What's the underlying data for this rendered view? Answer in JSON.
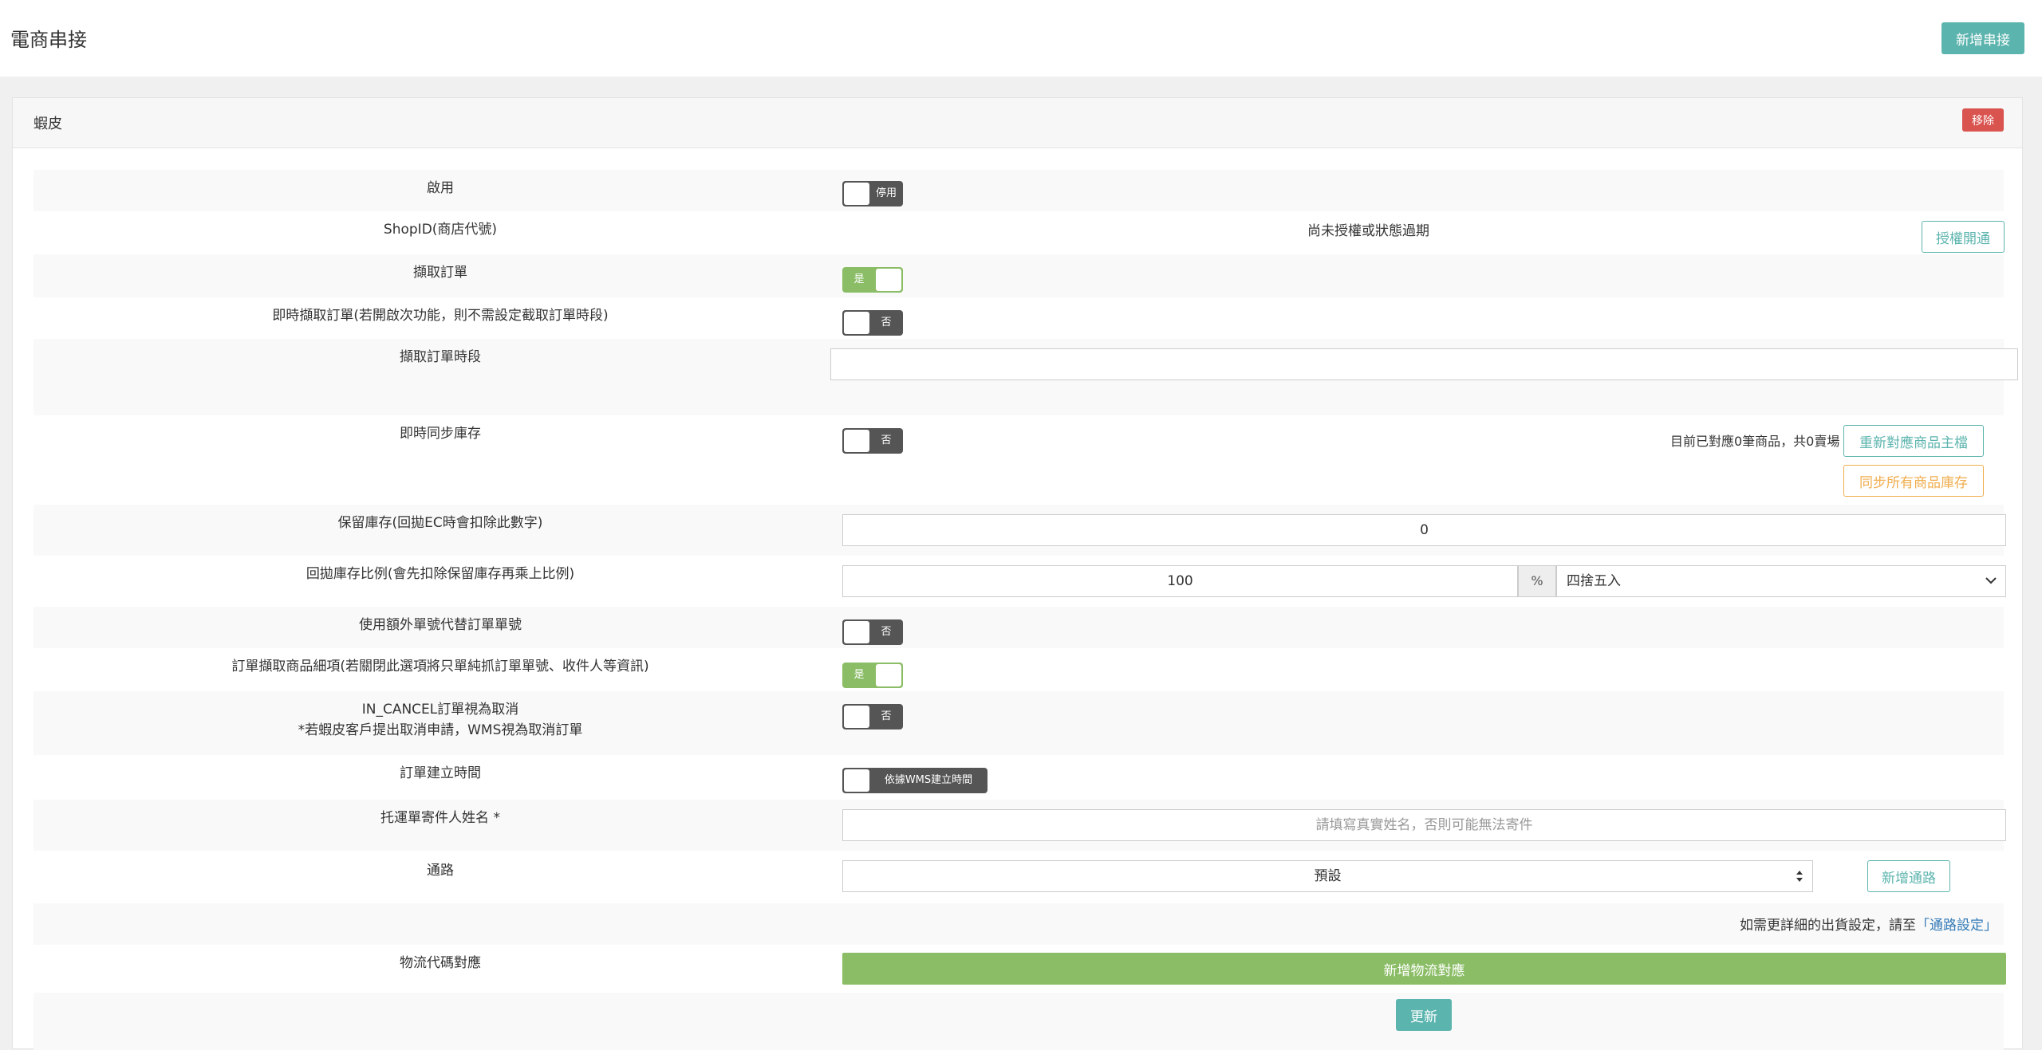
{
  "header": {
    "title": "電商串接",
    "add_button": "新增串接"
  },
  "panel": {
    "title": "蝦皮",
    "remove_button": "移除"
  },
  "rows": {
    "enable": {
      "label": "啟用",
      "toggle": "停用"
    },
    "shopid": {
      "label": "ShopID(商店代號)",
      "status": "尚未授權或狀態過期",
      "button": "授權開通"
    },
    "fetch_orders": {
      "label": "擷取訂單",
      "toggle": "是"
    },
    "realtime_fetch": {
      "label": "即時擷取訂單(若開啟次功能，則不需設定截取訂單時段)",
      "toggle": "否"
    },
    "fetch_period": {
      "label": "擷取訂單時段",
      "value": ""
    },
    "realtime_stock": {
      "label": "即時同步庫存",
      "toggle": "否",
      "info": "目前已對應0筆商品，共0賣場",
      "remap_button": "重新對應商品主檔",
      "sync_button": "同步所有商品庫存"
    },
    "reserve_stock": {
      "label": "保留庫存(回拋EC時會扣除此數字)",
      "value": "0"
    },
    "stock_ratio": {
      "label": "回拋庫存比例(會先扣除保留庫存再乘上比例)",
      "value": "100",
      "unit": "%",
      "rounding": "四捨五入"
    },
    "extra_number": {
      "label": "使用額外單號代替訂單單號",
      "toggle": "否"
    },
    "fetch_items": {
      "label": "訂單擷取商品細項(若關閉此選項將只單純抓訂單單號、收件人等資訊)",
      "toggle": "是"
    },
    "in_cancel": {
      "label": "IN_CANCEL訂單視為取消",
      "label2": "*若蝦皮客戶提出取消申請，WMS視為取消訂單",
      "toggle": "否"
    },
    "order_time": {
      "label": "訂單建立時間",
      "toggle": "依據WMS建立時間"
    },
    "sender_name": {
      "label": "托運單寄件人姓名 *",
      "placeholder": "請填寫真實姓名，否則可能無法寄件"
    },
    "channel": {
      "label": "通路",
      "selected": "預設",
      "add_button": "新增通路"
    },
    "channel_note": {
      "prefix": "如需更詳細的出貨設定，請至",
      "link": "「通路設定」"
    },
    "logistics": {
      "label": "物流代碼對應",
      "button": "新增物流對應"
    },
    "update": {
      "button": "更新"
    }
  }
}
